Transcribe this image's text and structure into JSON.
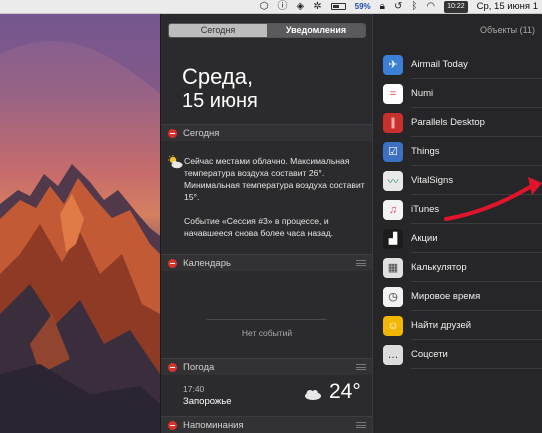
{
  "menubar": {
    "battery_percent": "59%",
    "battery_level": 0.59,
    "clock_chip": "10:22",
    "date_time": "Ср, 15 июня 1"
  },
  "nc": {
    "tabs": {
      "today": "Сегодня",
      "notifications": "Уведомления"
    },
    "weekday": "Среда,",
    "date": "15 июня",
    "sections": {
      "today": "Сегодня",
      "calendar": "Календарь",
      "weather": "Погода",
      "reminders": "Напоминания"
    },
    "today_summary": {
      "weather_line": "Сейчас местами облачно. Максимальная температура воздуха составит 26°. Минимальная температура воздуха составит 15°.",
      "event_line": "Событие «Сессия #3» в процессе, и начавшееся снова более часа назад."
    },
    "calendar_empty": "Нет событий",
    "weather": {
      "time": "17:40",
      "city": "Запорожье",
      "temp": "24°"
    }
  },
  "widgets": {
    "title": "Объекты (11)",
    "items": [
      {
        "label": "Airmail Today",
        "icon": "airmail-icon",
        "color": "#3b7fd6"
      },
      {
        "label": "Numi",
        "icon": "numi-icon",
        "color": "#ffffff"
      },
      {
        "label": "Parallels Desktop",
        "icon": "parallels-icon",
        "color": "#c9302c"
      },
      {
        "label": "Things",
        "icon": "things-icon",
        "color": "#3d6fc4"
      },
      {
        "label": "VitalSigns",
        "icon": "vitalsigns-icon",
        "color": "#e8e8e8"
      },
      {
        "label": "iTunes",
        "icon": "itunes-icon",
        "color": "#f4f4f4"
      },
      {
        "label": "Акции",
        "icon": "stocks-icon",
        "color": "#1c1c1c"
      },
      {
        "label": "Калькулятор",
        "icon": "calculator-icon",
        "color": "#e0e0e0"
      },
      {
        "label": "Мировое время",
        "icon": "world-clock-icon",
        "color": "#f2f2f2"
      },
      {
        "label": "Найти друзей",
        "icon": "find-friends-icon",
        "color": "#f2b705"
      },
      {
        "label": "Соцсети",
        "icon": "social-icon",
        "color": "#dcdcdc"
      }
    ]
  },
  "colors": {
    "arrow": "#e0142a",
    "minus": "#d9322b"
  }
}
